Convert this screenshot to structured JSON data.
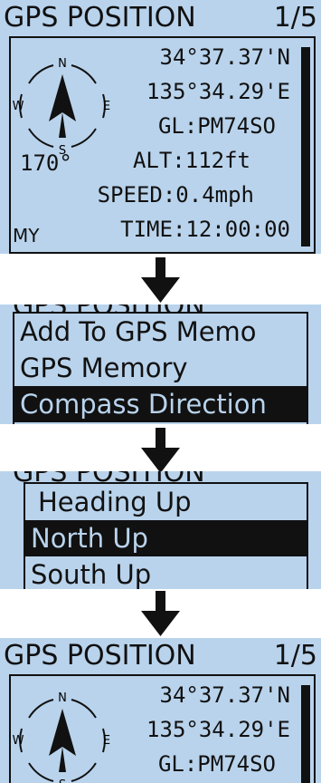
{
  "screen1": {
    "title": "GPS POSITION",
    "page": "1/5",
    "latitude": "34°37.37'N",
    "longitude": "135°34.29'E",
    "grid_locator": "GL:PM74SO",
    "altitude": "ALT:112ft",
    "speed": "SPEED:0.4mph",
    "time": "TIME:12:00:00",
    "heading": "170°",
    "position_source": "MY",
    "compass_letters": [
      "N",
      "E",
      "S",
      "W"
    ]
  },
  "menu1": {
    "items": [
      "Add To GPS Memo",
      "GPS Memory",
      "Compass Direction"
    ],
    "selected_index": 2
  },
  "menu2": {
    "items": [
      "Heading Up",
      "North Up",
      "South Up"
    ],
    "selected_index": 1
  },
  "screen2": {
    "title": "GPS POSITION",
    "page": "1/5",
    "latitude": "34°37.37'N",
    "longitude": "135°34.29'E",
    "grid_locator": "GL:PM74SO"
  },
  "colors": {
    "lcd_background": "#b9d3ec",
    "foreground": "#111111"
  }
}
